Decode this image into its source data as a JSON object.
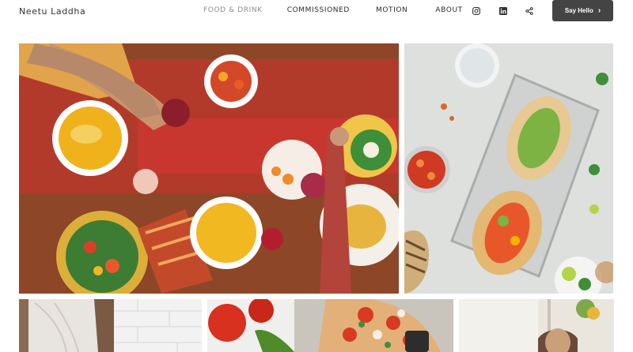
{
  "site": {
    "name": "Neetu Laddha"
  },
  "nav": {
    "items": [
      {
        "label": "FOOD & DRINK",
        "active": true
      },
      {
        "label": "COMMISSIONED",
        "active": false
      },
      {
        "label": "MOTION",
        "active": false
      },
      {
        "label": "ABOUT",
        "active": false
      }
    ]
  },
  "social": {
    "icons": [
      "instagram-icon",
      "linkedin-icon",
      "share-icon"
    ]
  },
  "cta": {
    "label": "Say Hello",
    "icon": "chevron-right-icon"
  },
  "colors": {
    "accent": "#444444",
    "nav_active": "#8c8c8c",
    "text": "#2b2b2b"
  }
}
